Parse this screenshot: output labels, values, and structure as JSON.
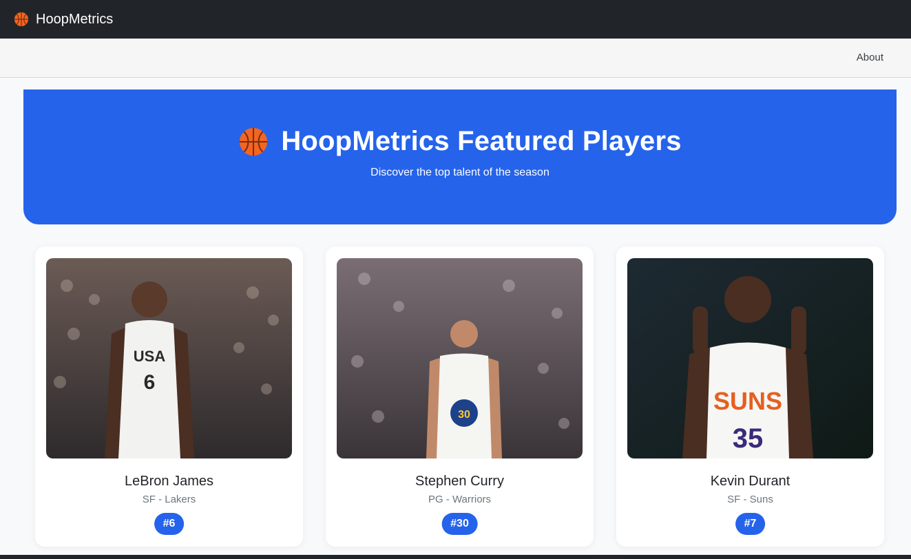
{
  "navbar": {
    "brand": "HoopMetrics",
    "brand_icon": "basketball-icon"
  },
  "subnav": {
    "about": "About"
  },
  "hero": {
    "icon": "basketball-icon",
    "title": "HoopMetrics Featured Players",
    "subtitle": "Discover the top talent of the season"
  },
  "players": [
    {
      "name": "LeBron James",
      "position": "SF - Lakers",
      "number": "#6"
    },
    {
      "name": "Stephen Curry",
      "position": "PG - Warriors",
      "number": "#30"
    },
    {
      "name": "Kevin Durant",
      "position": "SF - Suns",
      "number": "#7"
    }
  ],
  "colors": {
    "accent": "#2563eb",
    "navbar": "#212529",
    "subnav": "#f6f6f6"
  }
}
